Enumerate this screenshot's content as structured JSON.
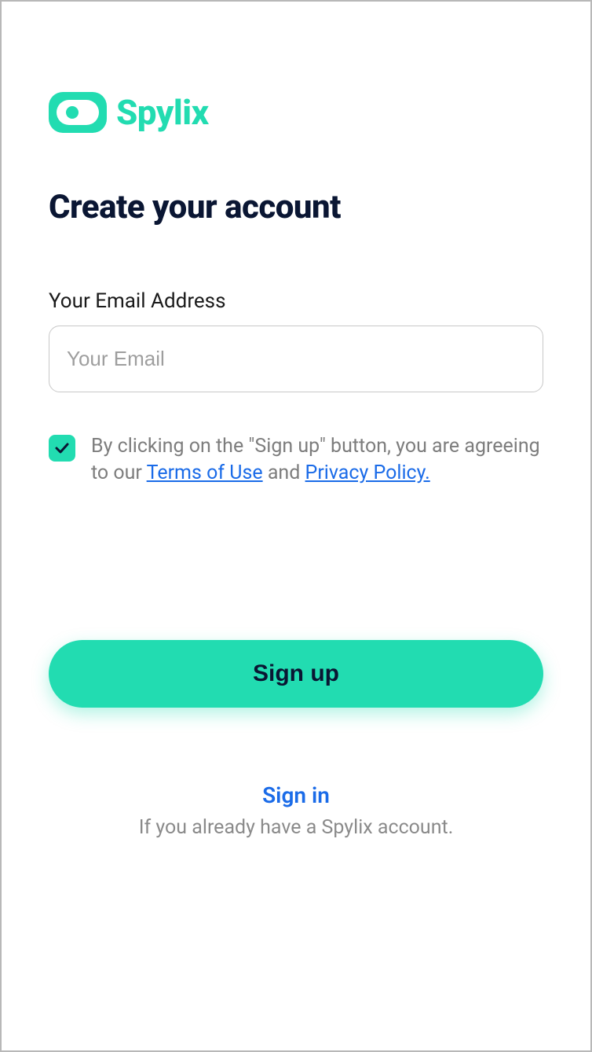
{
  "brand": {
    "name": "Spylix"
  },
  "title": "Create your account",
  "email": {
    "label": "Your Email Address",
    "placeholder": "Your Email",
    "value": ""
  },
  "agree": {
    "checked": true,
    "prefix": "By clicking on the \"Sign up\" button, you are agreeing to our ",
    "terms_label": "Terms of Use",
    "mid": " and ",
    "privacy_label": "Privacy Policy."
  },
  "signup_button": "Sign up",
  "signin": {
    "link": "Sign in",
    "sub": "If you already have a Spylix account."
  }
}
